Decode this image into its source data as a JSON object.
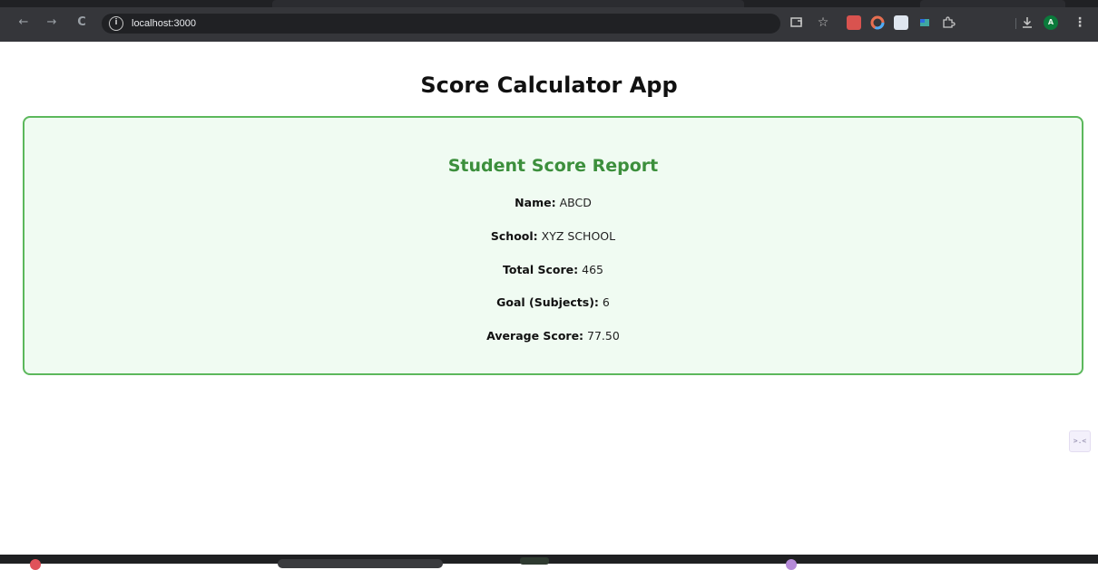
{
  "browser": {
    "url": "localhost:3000",
    "back_icon": "←",
    "forward_icon": "→",
    "reload_icon": "C",
    "info_icon": "i",
    "profile_initial": "A"
  },
  "app": {
    "title": "Score Calculator App"
  },
  "report": {
    "heading": "Student Score Report",
    "rows": [
      {
        "label": "Name:",
        "value": "ABCD"
      },
      {
        "label": "School:",
        "value": "XYZ SCHOOL"
      },
      {
        "label": "Total Score:",
        "value": "465"
      },
      {
        "label": "Goal (Subjects):",
        "value": "6"
      },
      {
        "label": "Average Score:",
        "value": "77.50"
      }
    ]
  },
  "widget": {
    "glyph": ">.<"
  },
  "colors": {
    "accent_green": "#3c8f3c",
    "card_border": "#5cb85c",
    "card_bg": "#f0fbf2"
  }
}
